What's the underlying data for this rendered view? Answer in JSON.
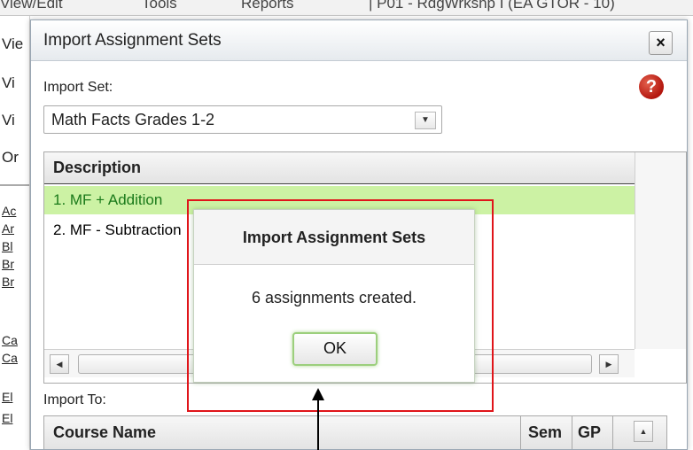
{
  "background": {
    "menu_items": [
      "View/Edit",
      "Tools",
      "Reports",
      "| P01 - RdgWrkshp I (EA GTOR - 10)"
    ],
    "left_labels": [
      "Vie",
      "Vi",
      "Vi",
      "Or"
    ],
    "left_links": [
      "Ac",
      "Ar",
      "Bl",
      "Br",
      "Br",
      "Ca",
      "Ca",
      "El",
      "El"
    ]
  },
  "dialog": {
    "title": "Import Assignment Sets",
    "close_glyph": "×",
    "import_set_label": "Import Set:",
    "help_glyph": "?",
    "import_set_value": "Math Facts Grades 1-2",
    "list_header": "Description",
    "rows": [
      "1. MF + Addition",
      "2. MF - Subtraction"
    ],
    "import_to_label": "Import To:",
    "table_columns": [
      "Course Name",
      "Sem",
      "GP"
    ]
  },
  "popup": {
    "title": "Import Assignment Sets",
    "message": "6 assignments created.",
    "ok_label": "OK"
  },
  "colors": {
    "selected_row_bg": "#ccf2a4",
    "annotation_red": "#e0151a",
    "help_red": "#b3160e"
  }
}
